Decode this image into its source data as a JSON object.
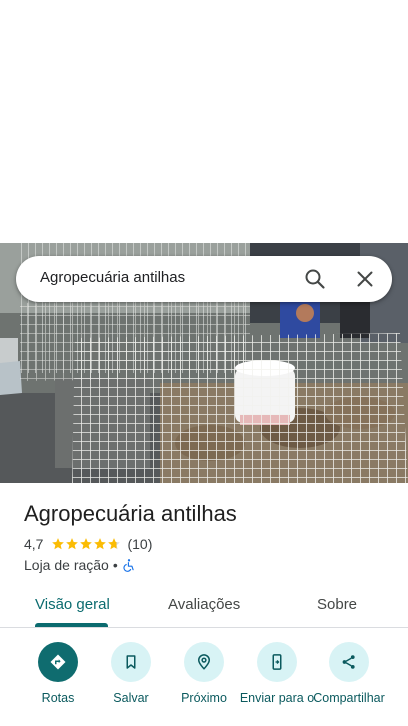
{
  "search": {
    "query": "Agropecuária antilhas"
  },
  "place": {
    "name": "Agropecuária antilhas",
    "rating": "4,7",
    "stars": 4.7,
    "review_count": "(10)",
    "category": "Loja de ração",
    "separator": "•",
    "accessibility_icon": "wheelchair-icon"
  },
  "tabs": [
    {
      "label": "Visão geral",
      "active": true
    },
    {
      "label": "Avaliações",
      "active": false
    },
    {
      "label": "Sobre",
      "active": false
    }
  ],
  "actions": [
    {
      "label": "Rotas",
      "icon": "directions-icon"
    },
    {
      "label": "Salvar",
      "icon": "bookmark-icon"
    },
    {
      "label": "Próximo",
      "icon": "nearby-icon"
    },
    {
      "label": "Enviar para o",
      "icon": "send-to-phone-icon"
    },
    {
      "label": "Compartilhar",
      "icon": "share-icon"
    }
  ],
  "colors": {
    "accent": "#0b6b6f",
    "star": "#fbbc04",
    "action_bg": "#d8f3f5"
  }
}
